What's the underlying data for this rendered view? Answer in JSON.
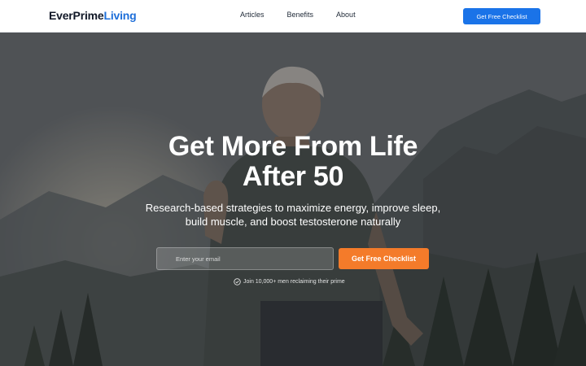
{
  "header": {
    "logo_part1": "EverPrime",
    "logo_part2": "Living",
    "nav": [
      {
        "label": "Articles"
      },
      {
        "label": "Benefits"
      },
      {
        "label": "About"
      }
    ],
    "cta_label": "Get Free Checklist"
  },
  "hero": {
    "title_line1": "Get More From Life",
    "title_line2": "After 50",
    "subtitle_line1": "Research-based strategies to maximize energy, improve sleep,",
    "subtitle_line2": "build muscle, and boost testosterone naturally",
    "email_placeholder": "Enter your email",
    "cta_label": "Get Free Checklist",
    "social_proof": "Join 10,000+ men reclaiming their prime",
    "social_proof_icon": "check-circle-icon"
  },
  "colors": {
    "brand_blue": "#1a73e8",
    "cta_orange": "#f47b2a",
    "text_dark": "#111827"
  }
}
